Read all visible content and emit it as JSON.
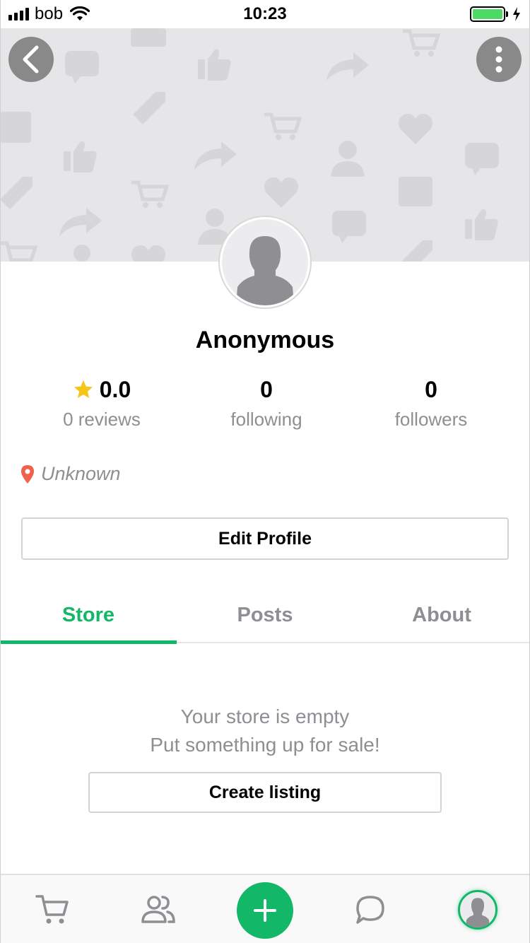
{
  "status_bar": {
    "carrier": "bob",
    "time": "10:23",
    "battery_level": 1.0,
    "icons": [
      "signal-icon",
      "wifi-icon",
      "battery-icon",
      "charging-icon"
    ]
  },
  "header": {
    "back_icon": "chevron-left-icon",
    "more_icon": "more-vertical-icon"
  },
  "profile": {
    "name": "Anonymous",
    "rating": "0.0",
    "reviews_label": "0 reviews",
    "following_count": "0",
    "following_label": "following",
    "followers_count": "0",
    "followers_label": "followers",
    "location": "Unknown",
    "edit_button": "Edit Profile"
  },
  "tabs": [
    {
      "label": "Store",
      "active": true
    },
    {
      "label": "Posts",
      "active": false
    },
    {
      "label": "About",
      "active": false
    }
  ],
  "store": {
    "empty_title": "Your store is empty",
    "empty_subtitle": "Put something up for sale!",
    "create_button": "Create listing"
  },
  "bottom_nav": {
    "items": [
      "cart-icon",
      "people-icon",
      "plus-icon",
      "chat-icon",
      "profile-avatar"
    ]
  },
  "colors": {
    "accent": "#12b868",
    "star": "#f5c518",
    "location_pin": "#f0624d",
    "muted_text": "#8e8e93",
    "cover_bg": "#e6e6e8"
  }
}
